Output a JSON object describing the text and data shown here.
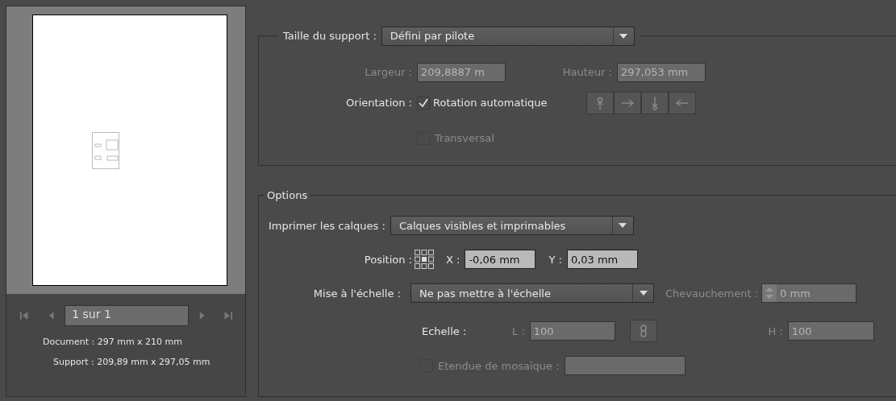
{
  "preview": {
    "page_field": "1 sur 1",
    "document_info": "Document : 297 mm x 210 mm",
    "support_info": "Support : 209,89 mm x 297,05 mm"
  },
  "media": {
    "size_label": "Taille du support :",
    "size": "Défini par pilote",
    "width_label": "Largeur :",
    "width": "209,8887 m",
    "height_label": "Hauteur :",
    "height": "297,053 mm",
    "dimensions_disabled": true,
    "orientation_label": "Orientation :",
    "auto_rotate": {
      "label": "Rotation automatique",
      "checked": true,
      "disabled": false
    },
    "orientation_buttons_disabled": true,
    "transverse": {
      "label": "Transversal",
      "checked": false,
      "disabled": true
    }
  },
  "options": {
    "legend": "Options",
    "layers_label": "Imprimer les calques :",
    "layers": "Calques visibles et imprimables",
    "position_label": "Position :",
    "x_label": "X :",
    "x": "-0,06 mm",
    "y_label": "Y :",
    "y": "0,03 mm",
    "scaling_label": "Mise à l'échelle :",
    "scaling": "Ne pas mettre à l'échelle",
    "overlap_label": "Chevauchement :",
    "overlap": "0 mm",
    "overlap_disabled": true,
    "scale_label": "Echelle :",
    "l_label": "L :",
    "l": "100",
    "h_label": "H :",
    "h": "100",
    "scale_disabled": true,
    "tile": {
      "label": "Etendue de mosaïque :",
      "checked": false,
      "disabled": true
    }
  }
}
